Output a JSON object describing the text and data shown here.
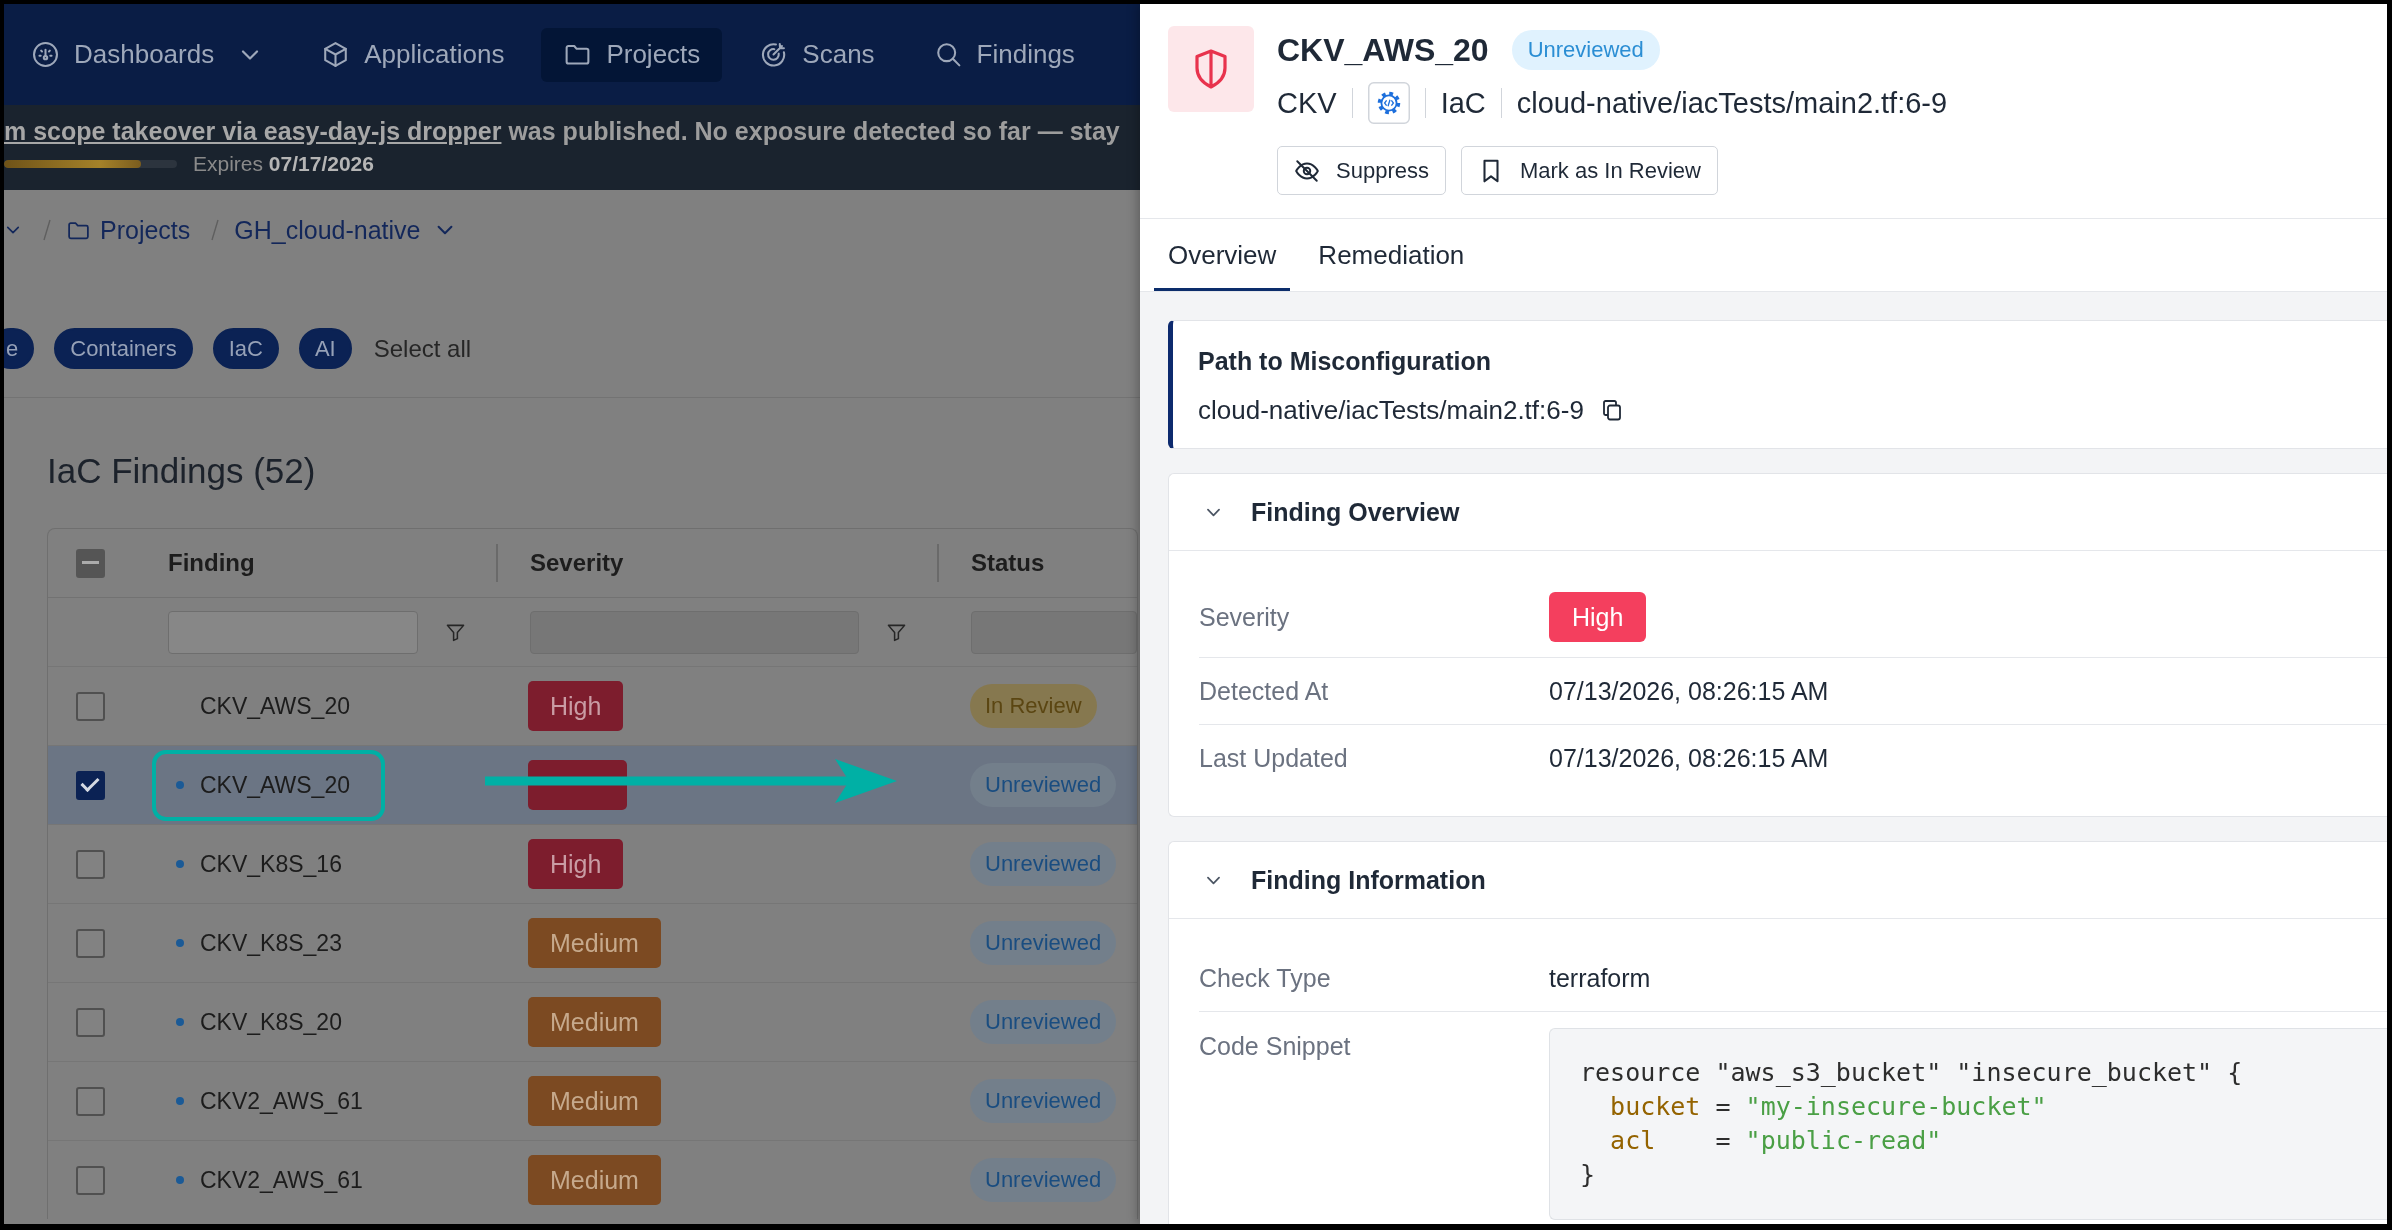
{
  "nav": {
    "items": [
      {
        "label": "Dashboards",
        "dropdown": true,
        "selected": false
      },
      {
        "label": "Applications",
        "dropdown": false,
        "selected": false
      },
      {
        "label": "Projects",
        "dropdown": false,
        "selected": true
      },
      {
        "label": "Scans",
        "dropdown": false,
        "selected": false
      },
      {
        "label": "Findings",
        "dropdown": false,
        "selected": false
      }
    ]
  },
  "banner": {
    "link": "m scope takeover via easy-day-js dropper",
    "message": "was published. No exposure detected so far — stay",
    "level": 0.79,
    "expiry": "Expires **07/17/2026**"
  },
  "breadcrumb": [
    {
      "label": "Projects",
      "kind": "folder",
      "dropdown": false
    },
    {
      "label": "GH_cloud-native",
      "kind": "project",
      "dropdown": true
    }
  ],
  "scope_chips": {
    "items": [
      {
        "label": "e",
        "selected": true
      },
      {
        "label": "Containers",
        "selected": true
      },
      {
        "label": "IaC",
        "selected": true
      },
      {
        "label": "AI",
        "selected": true
      }
    ],
    "select_all": "Select all"
  },
  "findings": {
    "title": "IaC Findings (52)",
    "select_all": {
      "mixed": true
    },
    "columns": [
      {
        "label": "Finding",
        "filter_disabled": false
      },
      {
        "label": "Severity",
        "filter_disabled": true
      },
      {
        "label": "Status",
        "filter_disabled": true
      }
    ],
    "rows": [
      {
        "finding": "CKV_AWS_20",
        "unread": false,
        "checked": false,
        "selected": false,
        "callout": false,
        "severity": {
          "label": "High",
          "kind": "high"
        },
        "status": {
          "label": "In Review",
          "kind": "in_review"
        }
      },
      {
        "finding": "CKV_AWS_20",
        "unread": true,
        "checked": true,
        "selected": true,
        "callout": true,
        "severity": {
          "kind": "high"
        },
        "status": {
          "label": "Unreviewed",
          "kind": "unreviewed"
        }
      },
      {
        "finding": "CKV_K8S_16",
        "unread": true,
        "checked": false,
        "selected": false,
        "callout": false,
        "severity": {
          "label": "High",
          "kind": "high"
        },
        "status": {
          "label": "Unreviewed",
          "kind": "unreviewed"
        }
      },
      {
        "finding": "CKV_K8S_23",
        "unread": true,
        "checked": false,
        "selected": false,
        "callout": false,
        "severity": {
          "label": "Medium",
          "kind": "medium"
        },
        "status": {
          "label": "Unreviewed",
          "kind": "unreviewed"
        }
      },
      {
        "finding": "CKV_K8S_20",
        "unread": true,
        "checked": false,
        "selected": false,
        "callout": false,
        "severity": {
          "label": "Medium",
          "kind": "medium"
        },
        "status": {
          "label": "Unreviewed",
          "kind": "unreviewed"
        }
      },
      {
        "finding": "CKV2_AWS_61",
        "unread": true,
        "checked": false,
        "selected": false,
        "callout": false,
        "severity": {
          "label": "Medium",
          "kind": "medium"
        },
        "status": {
          "label": "Unreviewed",
          "kind": "unreviewed"
        }
      },
      {
        "finding": "CKV2_AWS_61",
        "unread": true,
        "checked": false,
        "selected": false,
        "callout": false,
        "severity": {
          "label": "Medium",
          "kind": "medium"
        },
        "status": {
          "label": "Unreviewed",
          "kind": "unreviewed"
        }
      }
    ]
  },
  "detail": {
    "title": "CKV_AWS_20",
    "status": {
      "label": "Unreviewed",
      "kind": "unreviewed"
    },
    "scanner": "CKV",
    "category": "IaC",
    "location": "cloud-native/iacTests/main2.tf:6-9",
    "actions": [
      {
        "label": "Suppress"
      },
      {
        "label": "Mark as In Review"
      }
    ],
    "tabs": [
      {
        "label": "Overview",
        "selected": true
      },
      {
        "label": "Remediation",
        "selected": false
      }
    ],
    "path_card": {
      "title": "Path to Misconfiguration",
      "path": "cloud-native/iacTests/main2.tf:6-9"
    },
    "sections": [
      {
        "title": "Finding Overview",
        "expanded": true,
        "fields": [
          {
            "label": "Severity",
            "kind": "badge",
            "value": "High"
          },
          {
            "label": "Detected At",
            "kind": "text",
            "value": "07/13/2026, 08:26:15 AM"
          },
          {
            "label": "Last Updated",
            "kind": "text",
            "value": "07/13/2026, 08:26:15 AM"
          }
        ]
      },
      {
        "title": "Finding Information",
        "expanded": true,
        "fields": [
          {
            "label": "Check Type",
            "kind": "text",
            "value": "terraform"
          },
          {
            "label": "Code Snippet",
            "kind": "code",
            "lines": [
              [
                {
                  "kind": "plain",
                  "text": "resource \"aws_s3_bucket\" \"insecure_bucket\" {"
                }
              ],
              [
                {
                  "kind": "key",
                  "text": "  bucket"
                },
                {
                  "kind": "plain",
                  "text": " = "
                },
                {
                  "kind": "string",
                  "text": "\"my-insecure-bucket\""
                }
              ],
              [
                {
                  "kind": "key",
                  "text": "  acl"
                },
                {
                  "kind": "plain",
                  "text": "    = "
                },
                {
                  "kind": "string",
                  "text": "\"public-read\""
                }
              ],
              [
                {
                  "kind": "plain",
                  "text": "}"
                }
              ]
            ]
          }
        ]
      }
    ]
  }
}
